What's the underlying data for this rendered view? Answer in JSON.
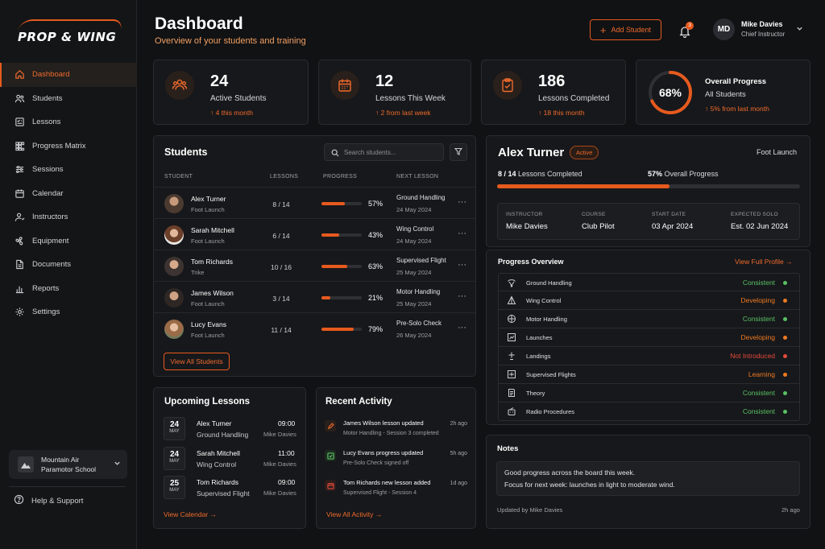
{
  "brand": {
    "name": "PROP & WING",
    "accent": "#E65A1E"
  },
  "nav": {
    "items": [
      {
        "label": "Dashboard",
        "icon": "home-icon",
        "active": true
      },
      {
        "label": "Students",
        "icon": "users-icon"
      },
      {
        "label": "Lessons",
        "icon": "checklist-icon"
      },
      {
        "label": "Progress Matrix",
        "icon": "grid-icon"
      },
      {
        "label": "Sessions",
        "icon": "sliders-icon"
      },
      {
        "label": "Calendar",
        "icon": "calendar-icon"
      },
      {
        "label": "Instructors",
        "icon": "instructors-icon"
      },
      {
        "label": "Equipment",
        "icon": "propeller-icon"
      },
      {
        "label": "Documents",
        "icon": "document-icon"
      },
      {
        "label": "Reports",
        "icon": "reports-icon"
      },
      {
        "label": "Settings",
        "icon": "gear-icon"
      }
    ],
    "school_line1": "Mountain Air",
    "school_line2": "Paramotor School",
    "help": "Help & Support"
  },
  "header": {
    "title": "Dashboard",
    "subtitle": "Overview of your students and training",
    "add_student": "Add Student",
    "notification_count": "3",
    "user_initials": "MD",
    "user_name": "Mike Davies",
    "user_role": "Chief Instructor"
  },
  "stats": [
    {
      "value": "24",
      "label": "Active Students",
      "delta": "4 this month",
      "icon": "users-icon"
    },
    {
      "value": "12",
      "label": "Lessons This Week",
      "delta": "2 from last week",
      "icon": "calendar-icon"
    },
    {
      "value": "186",
      "label": "Lessons Completed",
      "delta": "18 this month",
      "icon": "clipboard-check-icon"
    }
  ],
  "overall": {
    "percent": "68%",
    "fraction": 0.68,
    "title": "Overall Progress",
    "label": "All Students",
    "delta": "5% from last month"
  },
  "students": {
    "title": "Students",
    "search_placeholder": "Search students...",
    "columns": [
      "STUDENT",
      "LESSONS",
      "PROGRESS",
      "NEXT LESSON"
    ],
    "rows": [
      {
        "name": "Alex Turner",
        "type": "Foot Launch",
        "lessons": "8 / 14",
        "progress": 57,
        "progress_label": "57%",
        "next": "Ground Handling",
        "date": "24 May 2024"
      },
      {
        "name": "Sarah Mitchell",
        "type": "Foot Launch",
        "lessons": "6 / 14",
        "progress": 43,
        "progress_label": "43%",
        "next": "Wing Control",
        "date": "24 May 2024"
      },
      {
        "name": "Tom Richards",
        "type": "Trike",
        "lessons": "10 / 16",
        "progress": 63,
        "progress_label": "63%",
        "next": "Supervised Flight",
        "date": "25 May 2024"
      },
      {
        "name": "James Wilson",
        "type": "Foot Launch",
        "lessons": "3 / 14",
        "progress": 21,
        "progress_label": "21%",
        "next": "Motor Handling",
        "date": "25 May 2024"
      },
      {
        "name": "Lucy Evans",
        "type": "Foot Launch",
        "lessons": "11 / 14",
        "progress": 79,
        "progress_label": "79%",
        "next": "Pre-Solo Check",
        "date": "26 May 2024"
      }
    ],
    "view_all": "View All Students"
  },
  "upcoming": {
    "title": "Upcoming Lessons",
    "items": [
      {
        "day": "24",
        "month": "MAY",
        "name": "Alex Turner",
        "topic": "Ground Handling",
        "time": "09:00",
        "instructor": "Mike Davies"
      },
      {
        "day": "24",
        "month": "MAY",
        "name": "Sarah Mitchell",
        "topic": "Wing Control",
        "time": "11:00",
        "instructor": "Mike Davies"
      },
      {
        "day": "25",
        "month": "MAY",
        "name": "Tom Richards",
        "topic": "Supervised Flight",
        "time": "09:00",
        "instructor": "Mike Davies"
      }
    ],
    "link": "View Calendar"
  },
  "activity": {
    "title": "Recent Activity",
    "items": [
      {
        "title": "James Wilson lesson updated",
        "detail": "Motor Handling - Session 3 completed",
        "ago": "2h ago",
        "icon": "edit-icon"
      },
      {
        "title": "Lucy Evans progress updated",
        "detail": "Pre-Solo Check signed off",
        "ago": "5h ago",
        "icon": "check-icon"
      },
      {
        "title": "Tom Richards new lesson added",
        "detail": "Supervised Flight - Session 4",
        "ago": "1d ago",
        "icon": "calendar-icon"
      }
    ],
    "link": "View All Activity"
  },
  "profile": {
    "name": "Alex Turner",
    "status": "Active",
    "type": "Foot Launch",
    "lessons_done": "8 / 14",
    "lessons_label": "Lessons Completed",
    "overall_pct": "57%",
    "overall_label": "Overall Progress",
    "fraction": 0.57,
    "details": [
      {
        "key": "INSTRUCTOR",
        "value": "Mike Davies"
      },
      {
        "key": "COURSE",
        "value": "Club Pilot"
      },
      {
        "key": "START DATE",
        "value": "03 Apr 2024"
      },
      {
        "key": "EXPECTED SOLO",
        "value": "Est. 02 Jun 2024"
      }
    ]
  },
  "progress_overview": {
    "title": "Progress Overview",
    "link": "View Full Profile",
    "skills": [
      {
        "name": "Ground Handling",
        "status": "Consistent",
        "color": "#59C063"
      },
      {
        "name": "Wing Control",
        "status": "Developing",
        "color": "#EF7A22"
      },
      {
        "name": "Motor Handling",
        "status": "Consistent",
        "color": "#59C063"
      },
      {
        "name": "Launches",
        "status": "Developing",
        "color": "#EF7A22"
      },
      {
        "name": "Landings",
        "status": "Not Introduced",
        "color": "#E5493B"
      },
      {
        "name": "Supervised Flights",
        "status": "Learning",
        "color": "#EF7A22"
      },
      {
        "name": "Theory",
        "status": "Consistent",
        "color": "#59C063"
      },
      {
        "name": "Radio Procedures",
        "status": "Consistent",
        "color": "#59C063"
      }
    ]
  },
  "notes": {
    "title": "Notes",
    "line1": "Good progress across the board this week.",
    "line2": "Focus for next week: launches in light to moderate wind.",
    "updated_by": "Updated by Mike Davies",
    "ago": "2h ago"
  }
}
